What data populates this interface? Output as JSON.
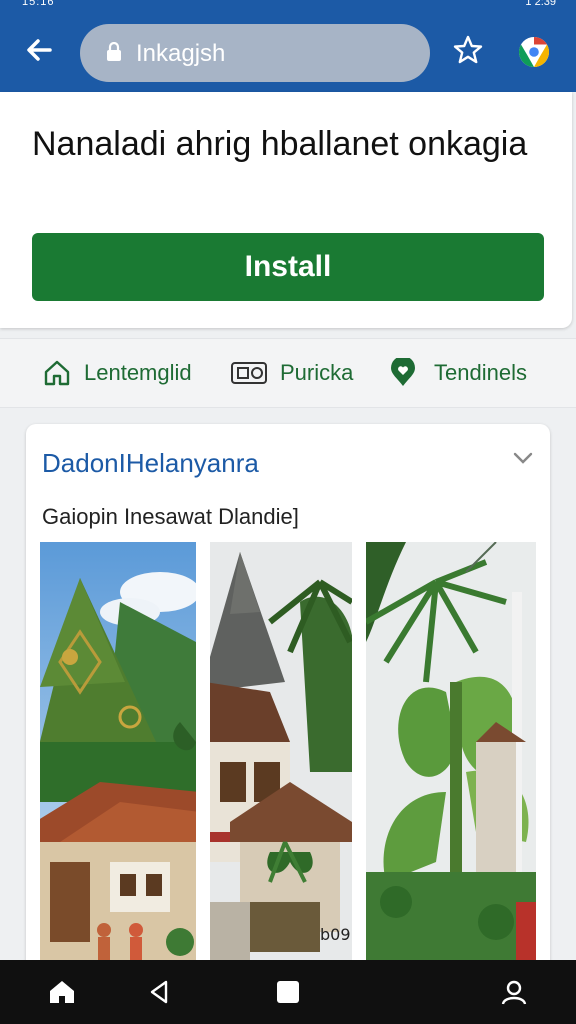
{
  "status_bar": {
    "left_text": "15:16",
    "right_text": "1 2:39"
  },
  "browser": {
    "url": "Inkagjsh"
  },
  "install_card": {
    "title": "Nanaladi ahrig hballanet onkagia",
    "install_label": "Install"
  },
  "nav": {
    "items": [
      {
        "label": "Lentemglid",
        "icon": "home-icon"
      },
      {
        "label": "Puricka",
        "icon": "ticket-icon"
      },
      {
        "label": "Tendinels",
        "icon": "location-heart-icon"
      }
    ]
  },
  "content_card": {
    "title": "DadonIHelanyanra",
    "subtitle": "Gaiopin Inesawat Dlandie]",
    "photos": [
      {
        "label": "",
        "caption": ""
      },
      {
        "label": "",
        "caption": "b09"
      },
      {
        "label": "",
        "caption": ""
      }
    ]
  },
  "system_nav": {
    "icons": [
      "home-icon",
      "back-icon",
      "recents-icon",
      "account-icon"
    ]
  },
  "colors": {
    "brand_blue": "#1c5aa6",
    "install_green": "#1a7a33",
    "nav_green": "#1e6b34"
  }
}
